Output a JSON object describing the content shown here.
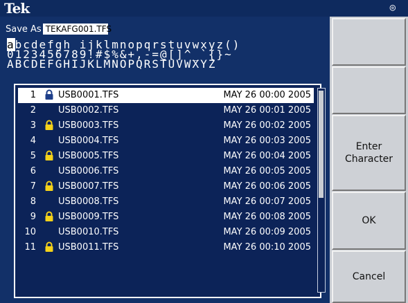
{
  "header": {
    "logo": "Tek",
    "status_icon": "◎"
  },
  "save": {
    "label": "Save As",
    "filename": "TEKAFG001.TFS"
  },
  "charset": {
    "selected_char": "a",
    "line1_rest": "bcdefgh ijklmnopqrstuvwxyz()",
    "line2": "0123456789!#$%&+,-=@[]^_`{}~",
    "line3": "ABCDEFGHIJKLMNOPQRSTUVWXYZ"
  },
  "files": [
    {
      "num": "1",
      "locked": true,
      "name": "USB0001.TFS",
      "date": "MAY 26 00:00 2005",
      "selected": true
    },
    {
      "num": "2",
      "locked": false,
      "name": "USB0002.TFS",
      "date": "MAY 26 00:01 2005",
      "selected": false
    },
    {
      "num": "3",
      "locked": true,
      "name": "USB0003.TFS",
      "date": "MAY 26 00:02 2005",
      "selected": false
    },
    {
      "num": "4",
      "locked": false,
      "name": "USB0004.TFS",
      "date": "MAY 26 00:03 2005",
      "selected": false
    },
    {
      "num": "5",
      "locked": true,
      "name": "USB0005.TFS",
      "date": "MAY 26 00:04 2005",
      "selected": false
    },
    {
      "num": "6",
      "locked": false,
      "name": "USB0006.TFS",
      "date": "MAY 26 00:05 2005",
      "selected": false
    },
    {
      "num": "7",
      "locked": true,
      "name": "USB0007.TFS",
      "date": "MAY 26 00:06 2005",
      "selected": false
    },
    {
      "num": "8",
      "locked": false,
      "name": "USB0008.TFS",
      "date": "MAY 26 00:07 2005",
      "selected": false
    },
    {
      "num": "9",
      "locked": true,
      "name": "USB0009.TFS",
      "date": "MAY 26 00:08 2005",
      "selected": false
    },
    {
      "num": "10",
      "locked": false,
      "name": "USB0010.TFS",
      "date": "MAY 26 00:09 2005",
      "selected": false
    },
    {
      "num": "11",
      "locked": true,
      "name": "USB0011.TFS",
      "date": "MAY 26 00:10 2005",
      "selected": false
    }
  ],
  "buttons": {
    "enter_character": "Enter\nCharacter",
    "ok": "OK",
    "cancel": "Cancel"
  },
  "colors": {
    "background": "#123068",
    "lock_selected": "#1e3f8a",
    "lock": "#f5d21a",
    "softkey": "#ced1d6"
  }
}
